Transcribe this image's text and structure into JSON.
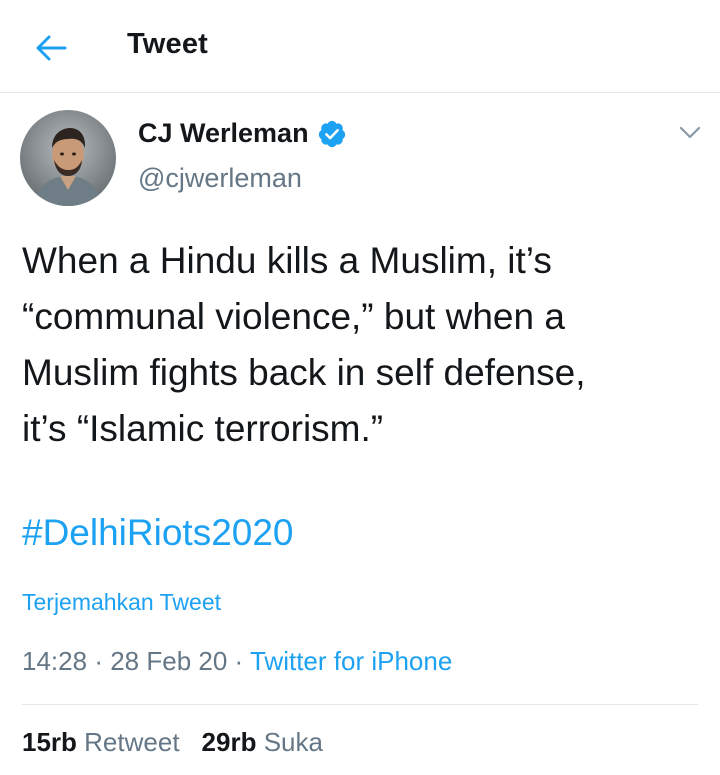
{
  "header": {
    "title": "Tweet",
    "back_icon": "arrow-left-icon"
  },
  "author": {
    "name": "CJ Werleman",
    "handle": "@cjwerleman",
    "verified_icon": "verified-badge-icon",
    "menu_icon": "chevron-down-icon"
  },
  "tweet": {
    "text": "When a Hindu kills a Muslim, it’s\n“communal violence,” but when a\nMuslim fights back in self defense,\nit’s “Islamic terrorism.”",
    "hashtag": "#DelhiRiots2020",
    "translate_label": "Terjemahkan Tweet",
    "time": "14:28",
    "date": "28 Feb 20",
    "separator": "·",
    "source": "Twitter for iPhone"
  },
  "stats": {
    "retweets_count": "15rb",
    "retweets_label": "Retweet",
    "likes_count": "29rb",
    "likes_label": "Suka"
  },
  "colors": {
    "accent": "#1da1f2",
    "text_primary": "#14171a",
    "text_secondary": "#657786",
    "divider": "#e1e8ed"
  }
}
